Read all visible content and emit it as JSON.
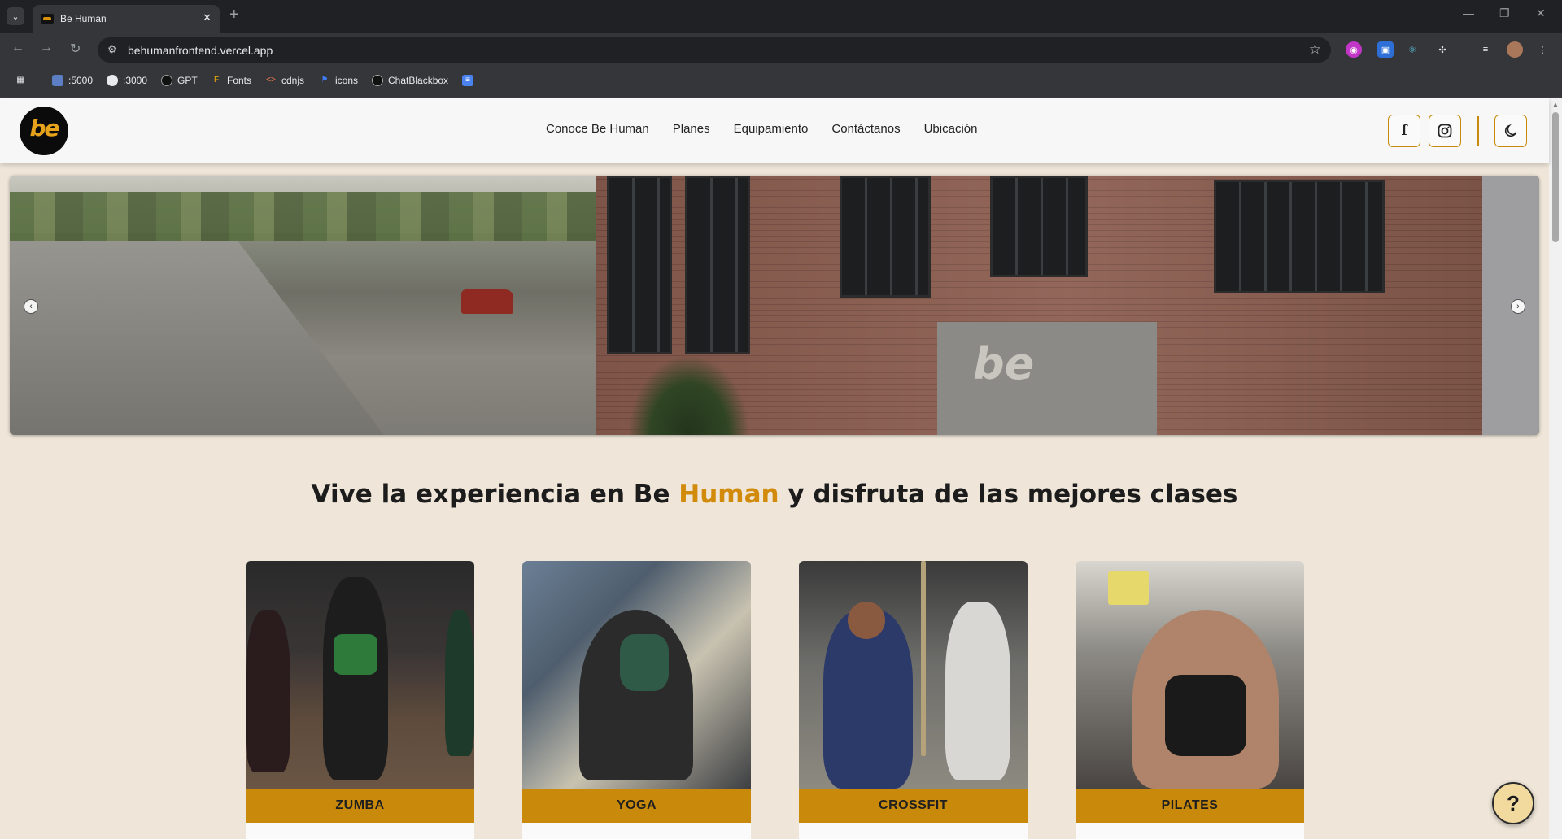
{
  "browser": {
    "tab_title": "Be Human",
    "url": "behumanfrontend.vercel.app",
    "bookmarks": [
      {
        "label": ":5000"
      },
      {
        "label": ":3000"
      },
      {
        "label": "GPT"
      },
      {
        "label": "Fonts"
      },
      {
        "label": "cdnjs"
      },
      {
        "label": "icons"
      },
      {
        "label": "ChatBlackbox"
      }
    ]
  },
  "site": {
    "logo_text": "be",
    "nav": [
      {
        "label": "Conoce Be Human"
      },
      {
        "label": "Planes"
      },
      {
        "label": "Equipamiento"
      },
      {
        "label": "Contáctanos"
      },
      {
        "label": "Ubicación"
      }
    ]
  },
  "hero": {
    "sign_text": "be"
  },
  "headline": {
    "before": "Vive la experiencia en Be ",
    "highlight": "Human",
    "after": " y disfruta de las mejores clases"
  },
  "classes": [
    {
      "label": "ZUMBA"
    },
    {
      "label": "YOGA"
    },
    {
      "label": "CROSSFIT"
    },
    {
      "label": "PILATES"
    }
  ],
  "help_button": {
    "label": "?"
  },
  "colors": {
    "accent": "#c98a0c",
    "highlight_text": "#d18a0a",
    "page_bg": "#efe6d9",
    "header_bg": "#f7f7f7"
  }
}
